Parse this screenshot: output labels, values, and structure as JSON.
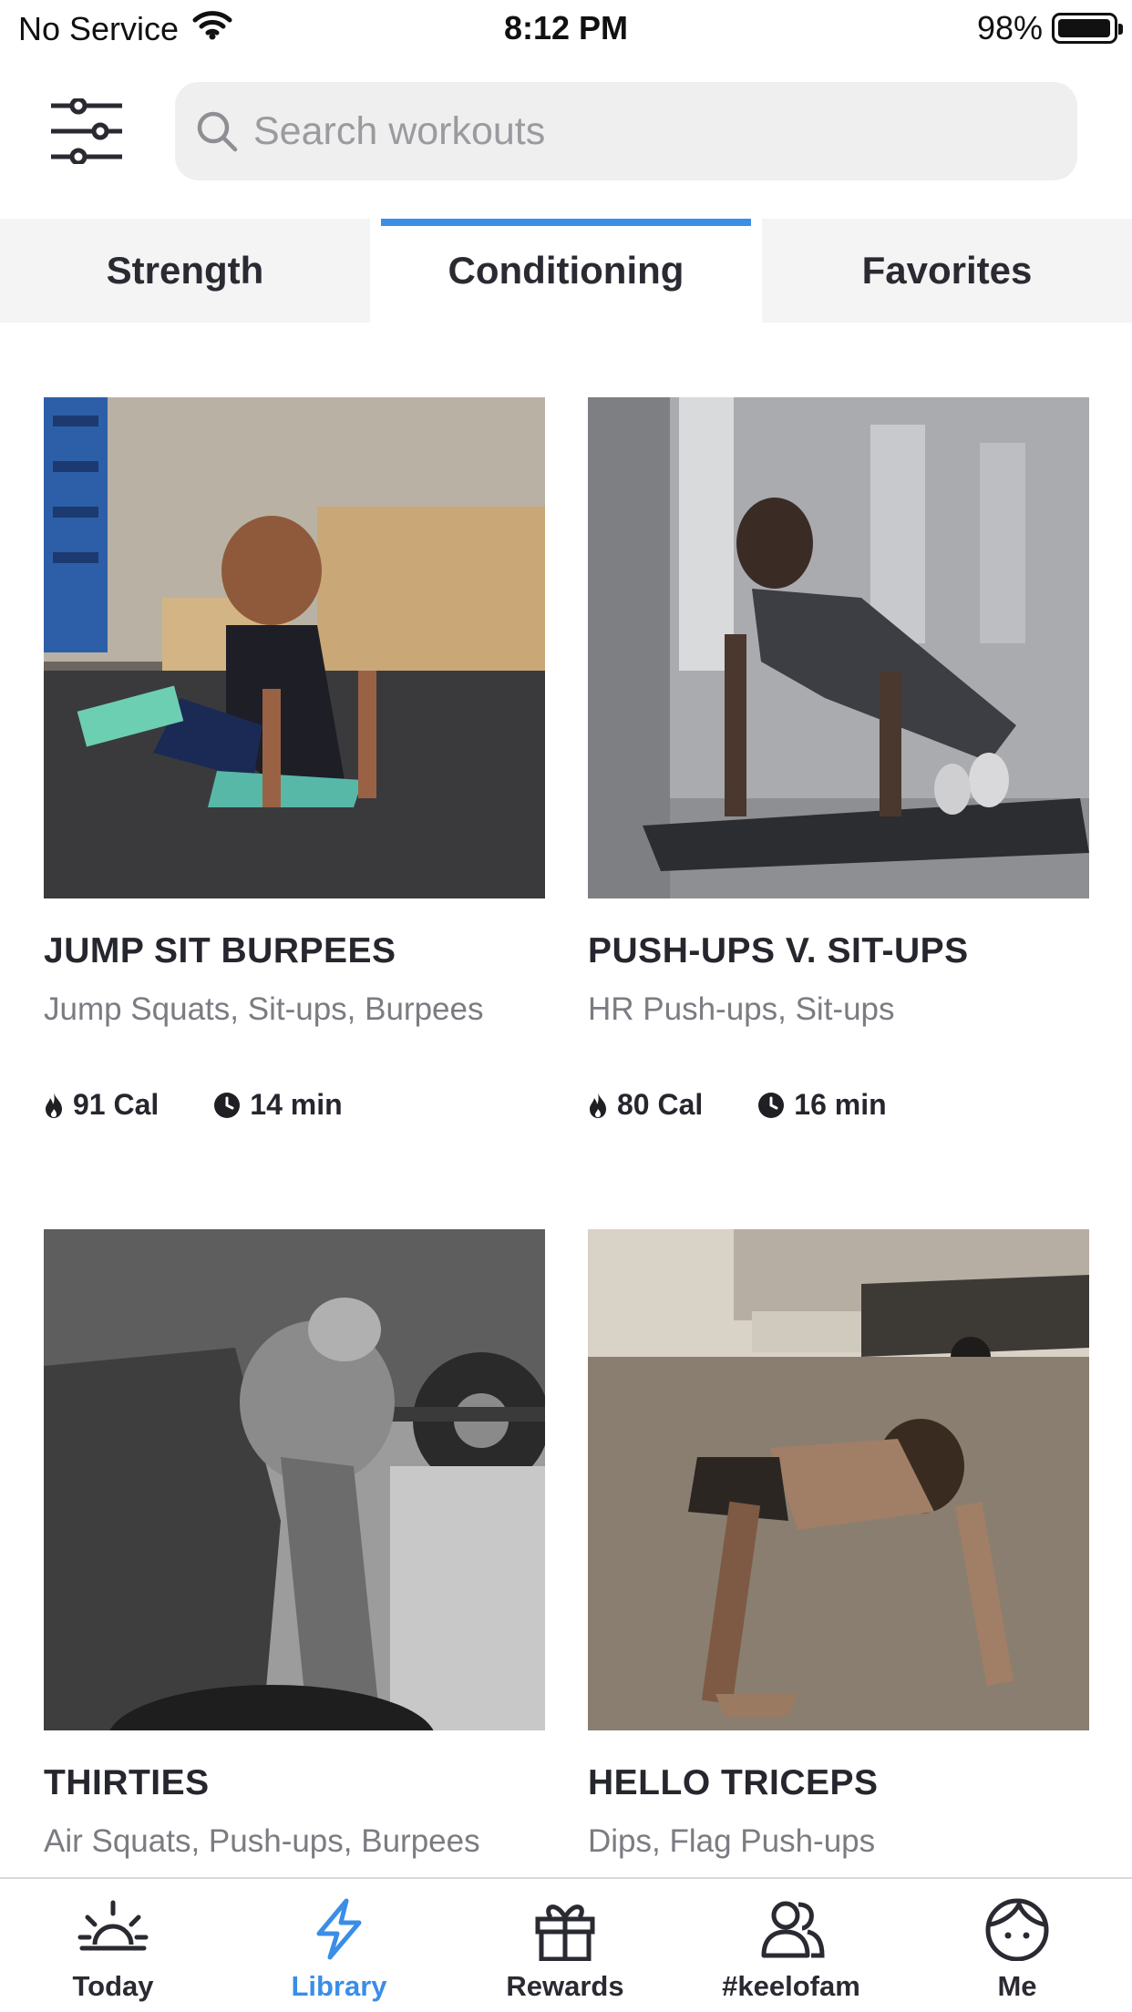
{
  "status_bar": {
    "carrier": "No Service",
    "time": "8:12 PM",
    "battery_percent_label": "98%",
    "battery_level": 0.98,
    "wifi_icon": "wifi-icon"
  },
  "header": {
    "filter_icon": "sliders-icon",
    "search_placeholder": "Search workouts",
    "search_value": ""
  },
  "tabs": [
    {
      "label": "Strength",
      "active": false
    },
    {
      "label": "Conditioning",
      "active": true
    },
    {
      "label": "Favorites",
      "active": false
    }
  ],
  "accent_color": "#3a8ee6",
  "workouts": [
    {
      "title": "JUMP SIT BURPEES",
      "exercises": "Jump Squats, Sit-ups, Burpees",
      "calories": "91 Cal",
      "duration": "14 min"
    },
    {
      "title": "PUSH-UPS V. SIT-UPS",
      "exercises": "HR Push-ups, Sit-ups",
      "calories": "80 Cal",
      "duration": "16 min"
    },
    {
      "title": "THIRTIES",
      "exercises": "Air Squats, Push-ups, Burpees"
    },
    {
      "title": "HELLO TRICEPS",
      "exercises": "Dips, Flag Push-ups"
    }
  ],
  "tab_bar": [
    {
      "label": "Today",
      "icon": "sunrise-icon",
      "active": false
    },
    {
      "label": "Library",
      "icon": "lightning-icon",
      "active": true
    },
    {
      "label": "Rewards",
      "icon": "gift-icon",
      "active": false
    },
    {
      "label": "#keelofam",
      "icon": "people-icon",
      "active": false
    },
    {
      "label": "Me",
      "icon": "face-icon",
      "active": false
    }
  ]
}
